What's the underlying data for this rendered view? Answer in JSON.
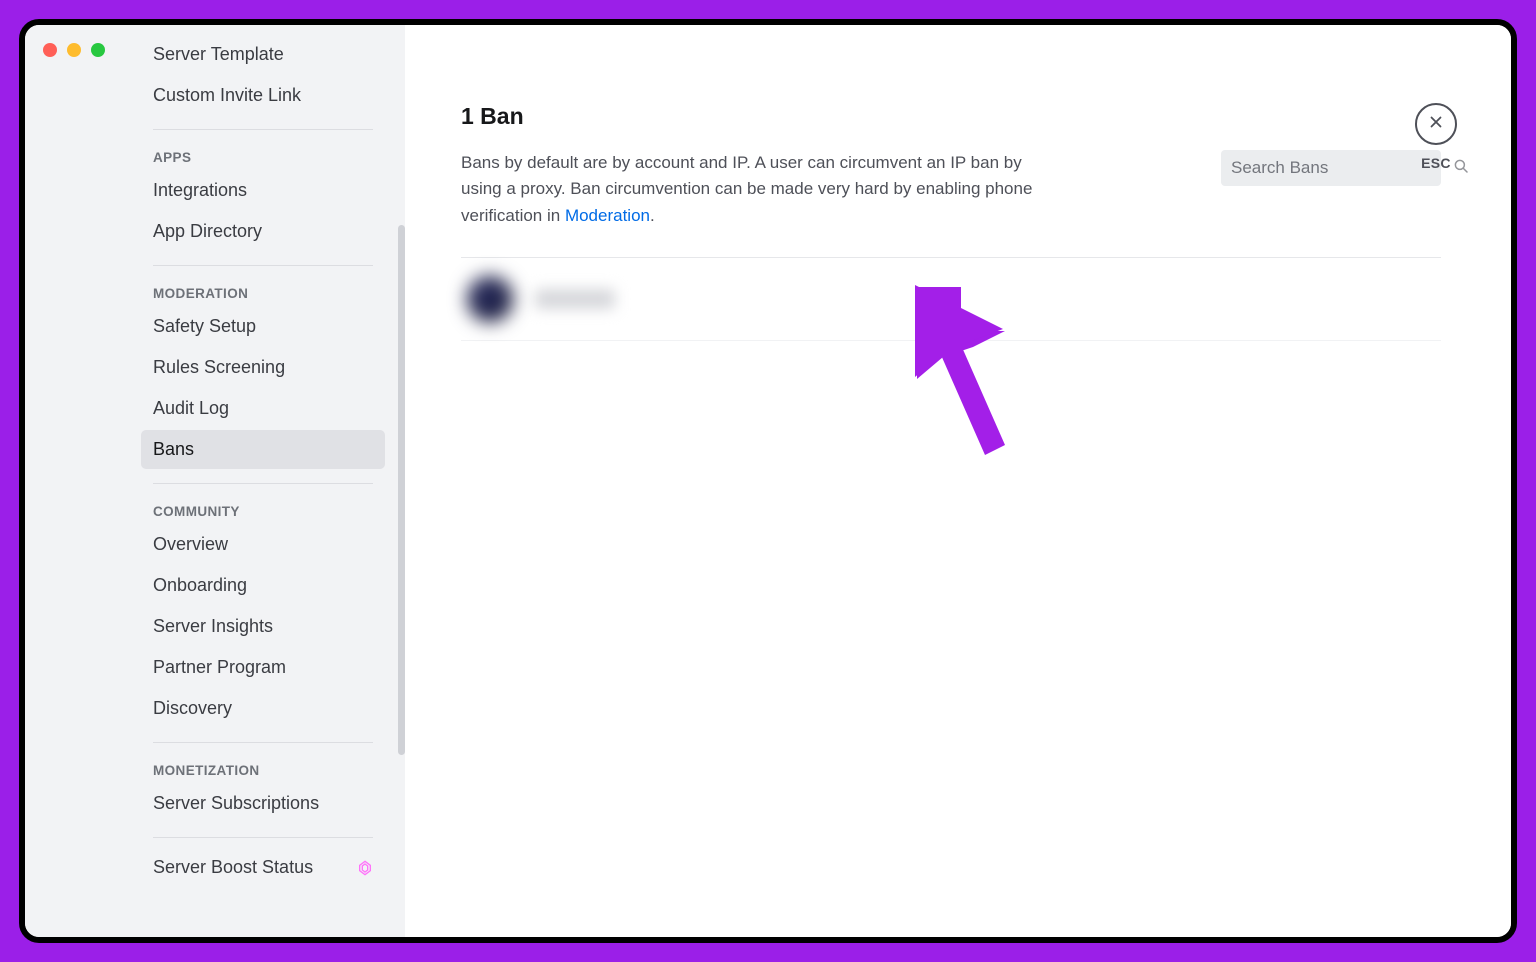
{
  "window": {
    "traffic_lights": [
      "close",
      "minimize",
      "zoom"
    ]
  },
  "sidebar": {
    "top_items": [
      {
        "label": "Server Template"
      },
      {
        "label": "Custom Invite Link"
      }
    ],
    "sections": [
      {
        "heading": "APPS",
        "items": [
          {
            "label": "Integrations"
          },
          {
            "label": "App Directory"
          }
        ]
      },
      {
        "heading": "MODERATION",
        "items": [
          {
            "label": "Safety Setup"
          },
          {
            "label": "Rules Screening"
          },
          {
            "label": "Audit Log"
          },
          {
            "label": "Bans",
            "active": true
          }
        ]
      },
      {
        "heading": "COMMUNITY",
        "items": [
          {
            "label": "Overview"
          },
          {
            "label": "Onboarding"
          },
          {
            "label": "Server Insights"
          },
          {
            "label": "Partner Program"
          },
          {
            "label": "Discovery"
          }
        ]
      },
      {
        "heading": "MONETIZATION",
        "items": [
          {
            "label": "Server Subscriptions"
          }
        ]
      }
    ],
    "boost_item": {
      "label": "Server Boost Status"
    }
  },
  "main": {
    "title": "1 Ban",
    "description_pre": "Bans by default are by account and IP. A user can circumvent an IP ban by using a proxy. Ban circumvention can be made very hard by enabling phone verification in ",
    "description_link": "Moderation",
    "description_post": ".",
    "search_placeholder": "Search Bans",
    "close_label": "ESC"
  },
  "colors": {
    "frame_outline": "#9b1fe8",
    "link": "#006be6",
    "sidebar_bg": "#f2f3f5",
    "active_bg": "#e0e1e5"
  }
}
